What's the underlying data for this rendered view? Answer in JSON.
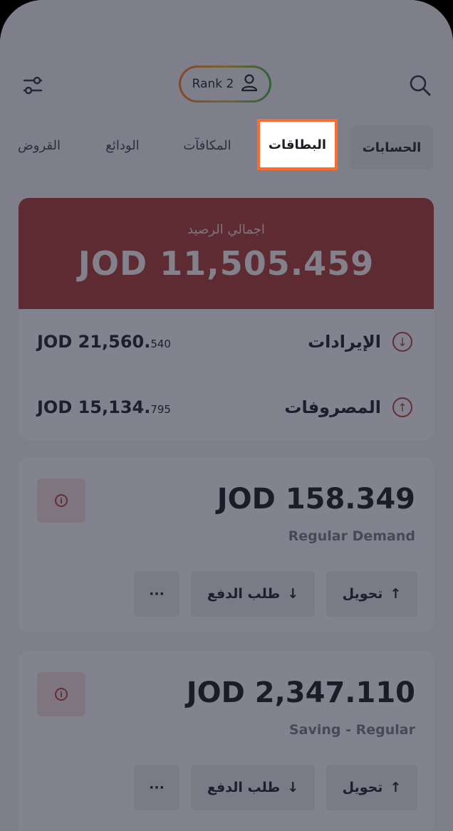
{
  "header": {
    "rank_label": "Rank 2"
  },
  "tabs": [
    {
      "label": "الحسابات"
    },
    {
      "label": "البطاقات"
    },
    {
      "label": "المكافآت"
    },
    {
      "label": "الودائع"
    },
    {
      "label": "القروض"
    }
  ],
  "summary": {
    "total_label": "اجمالي الرصيد",
    "total_amount": "JOD 11,505.459",
    "income_label": "الإيرادات",
    "income_amount_main": "JOD 21,560.",
    "income_amount_fraction": "540",
    "expense_label": "المصروفات",
    "expense_amount_main": "JOD 15,134.",
    "expense_amount_fraction": "795"
  },
  "accounts": [
    {
      "amount": "JOD 158.349",
      "type": "Regular Demand",
      "transfer_label": "تحويل",
      "request_label": "طلب الدفع",
      "more_label": "···"
    },
    {
      "amount": "JOD 2,347.110",
      "type": "Saving - Regular",
      "transfer_label": "تحويل",
      "request_label": "طلب الدفع",
      "more_label": "···"
    }
  ],
  "colors": {
    "accent": "#ff6a2d",
    "summary_bg": "#a8433d",
    "overlay": "rgba(20,20,40,0.5)"
  },
  "icons": {
    "filter": "filter-icon",
    "search": "search-icon",
    "user": "user-icon",
    "income": "arrow-down-circle-icon",
    "expense": "arrow-up-circle-icon",
    "info": "info-icon"
  }
}
